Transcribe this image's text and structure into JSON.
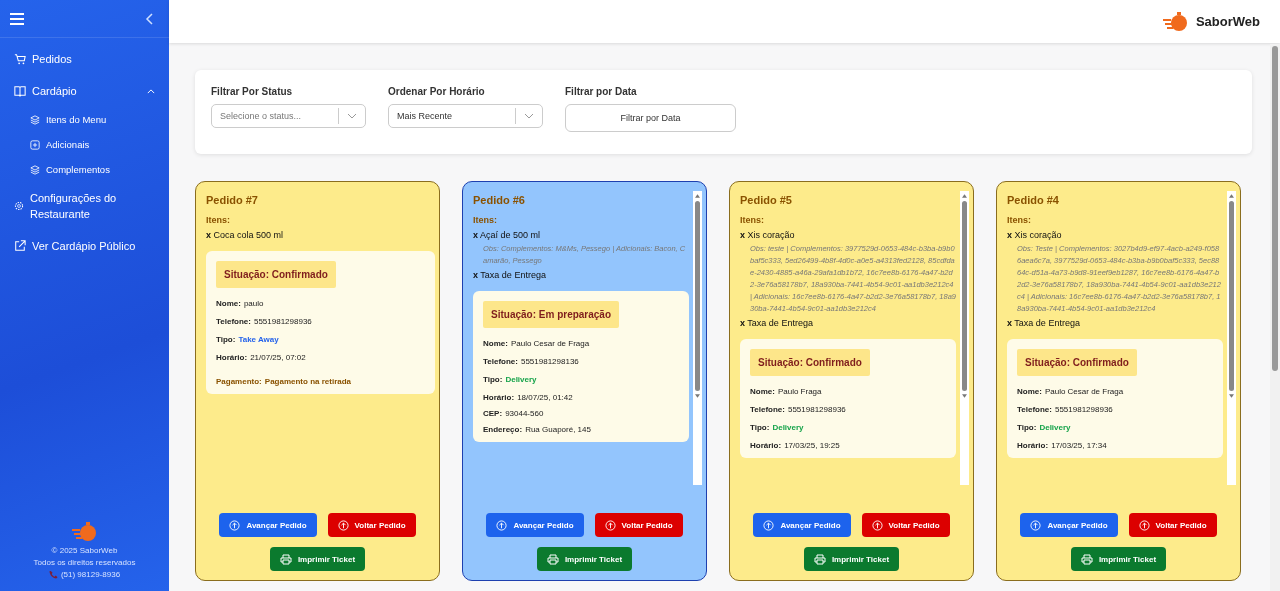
{
  "sidebar": {
    "items": [
      {
        "label": "Pedidos"
      },
      {
        "label": "Cardápio",
        "expanded": true,
        "children": [
          {
            "label": "Itens do Menu"
          },
          {
            "label": "Adicionais"
          },
          {
            "label": "Complementos"
          }
        ]
      },
      {
        "label": "Configurações do Restaurante"
      },
      {
        "label": "Ver Cardápio Público"
      }
    ],
    "footer": {
      "copyright": "© 2025 SaborWeb",
      "rights": "Todos os direitos reservados",
      "phone": "(51) 98129-8936"
    }
  },
  "header": {
    "brand": "SaborWeb"
  },
  "filters": [
    {
      "label": "Filtrar Por Status",
      "kind": "select",
      "placeholder": "Selecione o status..."
    },
    {
      "label": "Ordenar Por Horário",
      "kind": "select",
      "value": "Mais Recente"
    },
    {
      "label": "Filtrar por Data",
      "kind": "button",
      "value": "Filtrar por Data"
    }
  ],
  "orders": [
    {
      "title": "Pedido #7",
      "selected": false,
      "scrollbar": false,
      "items_label": "Itens:",
      "items": [
        {
          "text": "**x** Coca cola 500 ml"
        }
      ],
      "status": "Situação: Confirmado",
      "fields": [
        {
          "label": "Nome:",
          "value": "paulo",
          "kind": "plain"
        },
        {
          "label": "Telefone:",
          "value": "5551981298936",
          "kind": "plain"
        },
        {
          "label": "Tipo:",
          "value": "Take Away",
          "kind": "takeaway"
        },
        {
          "label": "Horário:",
          "value": "21/07/25, 07:02",
          "kind": "plain"
        },
        {
          "label": "Pagamento:",
          "value": "Pagamento na retirada",
          "kind": "payment"
        }
      ],
      "buttons": [
        "Avançar Pedido",
        "Voltar Pedido",
        "Imprimir Ticket"
      ]
    },
    {
      "title": "Pedido #6",
      "selected": true,
      "scrollbar": true,
      "items_label": "Itens:",
      "items": [
        {
          "text": "**x** Açaí de 500 ml",
          "obs": "Obs: Complementos: M&Ms, Pessego | Adicionais: Bacon, Camarão, Pessego"
        },
        {
          "text": "**x** Taxa de Entrega"
        }
      ],
      "status": "Situação: Em preparação",
      "fields": [
        {
          "label": "Nome:",
          "value": "Paulo Cesar de Fraga",
          "kind": "plain"
        },
        {
          "label": "Telefone:",
          "value": "5551981298136",
          "kind": "plain"
        },
        {
          "label": "Tipo:",
          "value": "Delivery",
          "kind": "delivery"
        },
        {
          "label": "Horário:",
          "value": "18/07/25, 01:42",
          "kind": "plain"
        },
        {
          "label": "CEP:",
          "value": "93044-560",
          "kind": "address"
        },
        {
          "label": "Endereço:",
          "value": "Rua Guaporé, 145",
          "kind": "address"
        }
      ],
      "buttons": [
        "Avançar Pedido",
        "Voltar Pedido",
        "Imprimir Ticket"
      ]
    },
    {
      "title": "Pedido #5",
      "selected": false,
      "scrollbar": true,
      "items_label": "Itens:",
      "items": [
        {
          "text": "**x** Xis coração",
          "obs": "Obs: teste | Complementos: 3977529d-0653-484c-b3ba-b9b0baf5c333, 5ed26499-4b8f-4d0c-a0e5-a4313fed2128, 85cdfdae-2430-4885-a46a-29afa1db1b72, 16c7ee8b-6176-4a47-b2d2-3e76a58178b7, 18a930ba-7441-4b54-9c01-aa1db3e212c4 | Adicionais: 16c7ee8b-6176-4a47-b2d2-3e76a58178b7, 18a930ba-7441-4b54-9c01-aa1db3e212c4"
        },
        {
          "text": "**x** Taxa de Entrega"
        }
      ],
      "status": "Situação: Confirmado",
      "fields": [
        {
          "label": "Nome:",
          "value": "Paulo Fraga",
          "kind": "plain"
        },
        {
          "label": "Telefone:",
          "value": "5551981298936",
          "kind": "plain"
        },
        {
          "label": "Tipo:",
          "value": "Delivery",
          "kind": "delivery"
        },
        {
          "label": "Horário:",
          "value": "17/03/25, 19:25",
          "kind": "plain"
        }
      ],
      "buttons": [
        "Avançar Pedido",
        "Voltar Pedido",
        "Imprimir Ticket"
      ]
    },
    {
      "title": "Pedido #4",
      "selected": false,
      "scrollbar": true,
      "items_label": "Itens:",
      "items": [
        {
          "text": "**x** Xis coração",
          "obs": "Obs: Teste | Complementos: 3027b4d9-ef97-4acb-a249-f0586aea6c7a, 3977529d-0653-484c-b3ba-b9b0baf5c333, 5ec8864c-d51a-4a73-b9d8-91eef9eb1287, 16c7ee8b-6176-4a47-b2d2-3e76a58178b7, 18a930ba-7441-4b54-9c01-aa1db3e212c4 | Adicionais: 16c7ee8b-6176-4a47-b2d2-3e76a58178b7, 18a930ba-7441-4b54-9c01-aa1db3e212c4"
        },
        {
          "text": "**x** Taxa de Entrega"
        }
      ],
      "status": "Situação: Confirmado",
      "fields": [
        {
          "label": "Nome:",
          "value": "Paulo Cesar de Fraga",
          "kind": "plain"
        },
        {
          "label": "Telefone:",
          "value": "5551981298936",
          "kind": "plain"
        },
        {
          "label": "Tipo:",
          "value": "Delivery",
          "kind": "delivery"
        },
        {
          "label": "Horário:",
          "value": "17/03/25, 17:34",
          "kind": "plain"
        }
      ],
      "buttons": [
        "Avançar Pedido",
        "Voltar Pedido",
        "Imprimir Ticket"
      ]
    }
  ]
}
